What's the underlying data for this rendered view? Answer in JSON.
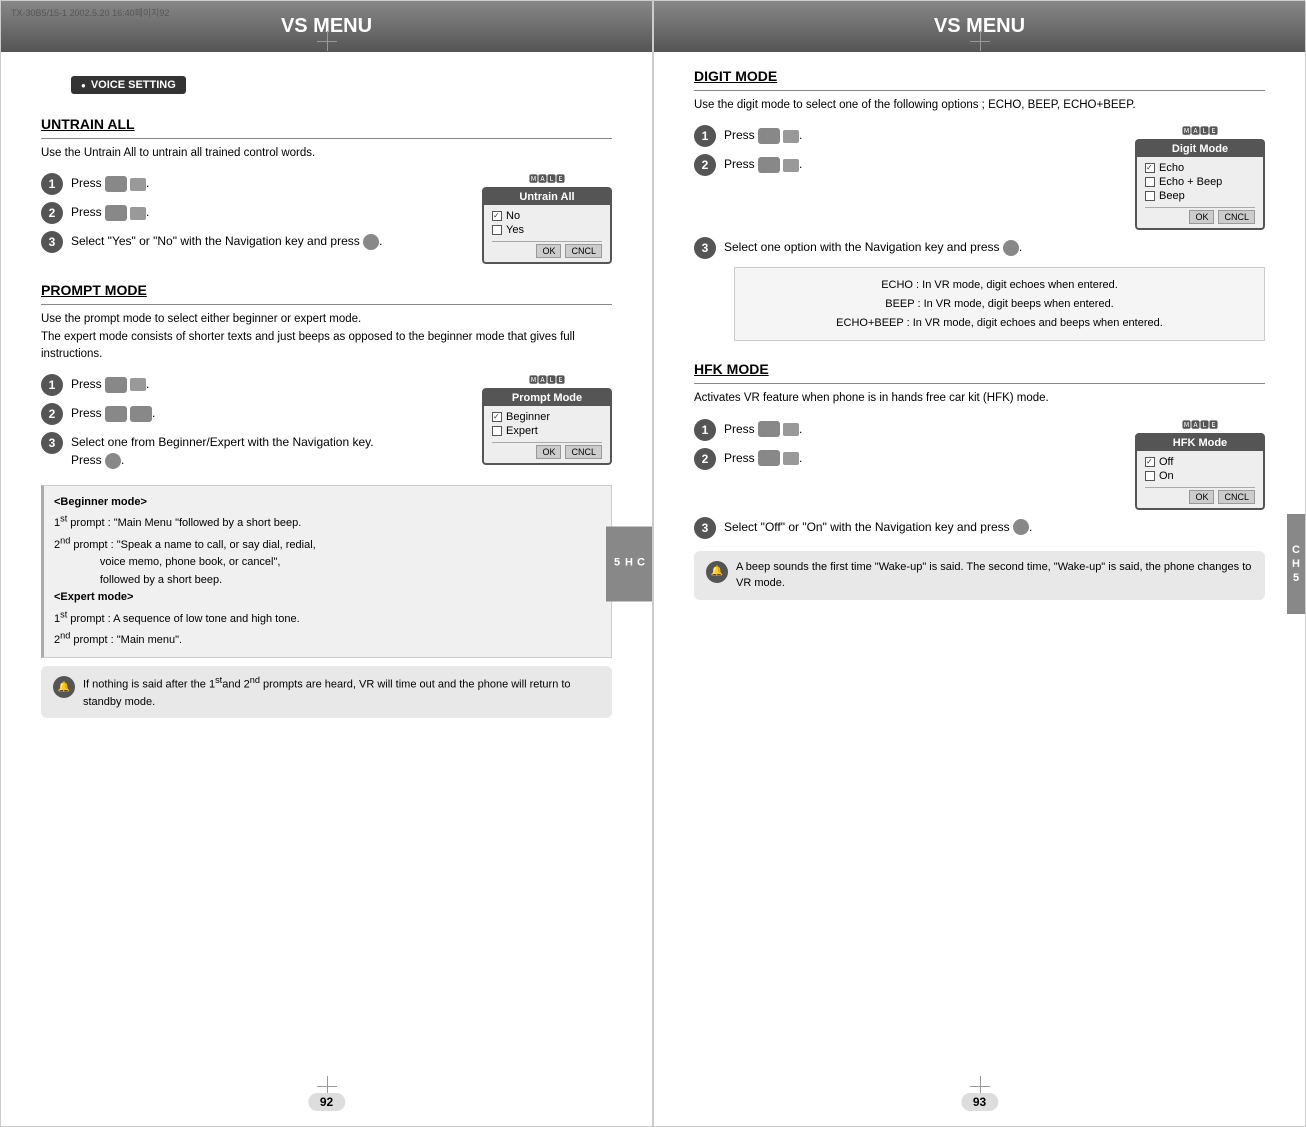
{
  "left_page": {
    "header": "VS MENU",
    "top_label": "TX-30B5/15-1  2002.5.20 16:40페이지92",
    "badge": "VOICE SETTING",
    "ch_tab": "CH 5",
    "page_num": "92",
    "sections": [
      {
        "id": "untrain-all",
        "title": "UNTRAIN ALL",
        "desc": "Use the Untrain All to untrain all trained control words.",
        "steps": [
          {
            "num": "1",
            "text": "Press"
          },
          {
            "num": "2",
            "text": "Press"
          },
          {
            "num": "3",
            "text": "Select \"Yes\" or \"No\" with the Navigation key  and press   ."
          }
        ],
        "screen": {
          "top_icons": "🄼🄰🄻🄴",
          "title": "Untrain All",
          "items": [
            {
              "checked": true,
              "label": "No"
            },
            {
              "checked": false,
              "label": "Yes"
            }
          ],
          "buttons": [
            "OK",
            "CNCL"
          ]
        }
      },
      {
        "id": "prompt-mode",
        "title": "PROMPT MODE",
        "desc": "Use the prompt mode to select either beginner or expert mode.\nThe expert mode consists of shorter texts and just beeps as opposed to the beginner mode that gives full instructions.",
        "steps": [
          {
            "num": "1",
            "text": "Press"
          },
          {
            "num": "2",
            "text": "Press"
          },
          {
            "num": "3",
            "text": "Select one from Beginner/Expert with the Navigation key.\nPress   ."
          }
        ],
        "screen": {
          "top_icons": "🄼🄰🄻🄴",
          "title": "Prompt Mode",
          "items": [
            {
              "checked": true,
              "label": "Beginner"
            },
            {
              "checked": false,
              "label": "Expert"
            }
          ],
          "buttons": [
            "OK",
            "CNCL"
          ]
        },
        "info_box": {
          "beginner_title": "<Beginner mode>",
          "beginner_lines": [
            "1st prompt : \"Main Menu \"followed by a short beep.",
            "2nd prompt : \"Speak a name to call, or say dial, redial,",
            "             voice memo, phone book, or cancel\",",
            "             followed by a short beep."
          ],
          "expert_title": "<Expert mode>",
          "expert_lines": [
            "1st prompt : A sequence of low tone and high tone.",
            "2nd prompt : \"Main menu\"."
          ]
        },
        "note": "If nothing is said after the 1st and 2nd prompts are heard, VR will time out and the phone will return to standby mode."
      }
    ]
  },
  "right_page": {
    "header": "VS MENU",
    "ch_tab": "CH 5",
    "page_num": "93",
    "sections": [
      {
        "id": "digit-mode",
        "title": "DIGIT MODE",
        "desc": "Use the digit mode to select one of the following options ; ECHO, BEEP, ECHO+BEEP.",
        "steps": [
          {
            "num": "1",
            "text": "Press"
          },
          {
            "num": "2",
            "text": "Press"
          },
          {
            "num": "3",
            "text": "Select one option with the Navigation key and press   ."
          }
        ],
        "screen": {
          "top_icons": "🄼🄰🄻🄴",
          "title": "Digit Mode",
          "items": [
            {
              "checked": true,
              "label": "Echo"
            },
            {
              "checked": false,
              "label": "Echo + Beep"
            },
            {
              "checked": false,
              "label": "Beep"
            }
          ],
          "buttons": [
            "OK",
            "CNCL"
          ]
        },
        "echo_box": [
          "ECHO : In VR mode, digit echoes when entered.",
          "BEEP :  In VR mode, digit beeps when entered.",
          "ECHO+BEEP :  In VR mode, digit echoes and beeps when entered."
        ]
      },
      {
        "id": "hfk-mode",
        "title": "HFK MODE",
        "desc": "Activates VR feature when phone is in hands free car kit (HFK) mode.",
        "steps": [
          {
            "num": "1",
            "text": "Press"
          },
          {
            "num": "2",
            "text": "Press"
          },
          {
            "num": "3",
            "text": "Select “Off” or “On” with the Navigation  key and press   ."
          }
        ],
        "screen": {
          "top_icons": "🄼🄰🄻🄴",
          "title": "HFK Mode",
          "items": [
            {
              "checked": true,
              "label": "Off"
            },
            {
              "checked": false,
              "label": "On"
            }
          ],
          "buttons": [
            "OK",
            "CNCL"
          ]
        },
        "note": "A beep sounds the first time \"Wake-up\" is said. The second time, \"Wake-up\" is said, the phone changes to VR mode."
      }
    ]
  }
}
